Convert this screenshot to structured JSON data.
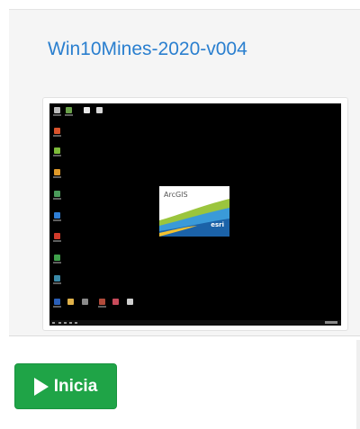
{
  "card": {
    "title": "Win10Mines-2020-v004",
    "thumbnail": {
      "splash_logo_text": "ArcGIS",
      "splash_brand_text": "esri"
    }
  },
  "actions": {
    "start_label": "Inicia",
    "start_icon": "play-icon"
  },
  "colors": {
    "title_link": "#2a7fcf",
    "start_button": "#1fa447",
    "card_background": "#f5f5f5",
    "desktop_background": "#000000"
  }
}
